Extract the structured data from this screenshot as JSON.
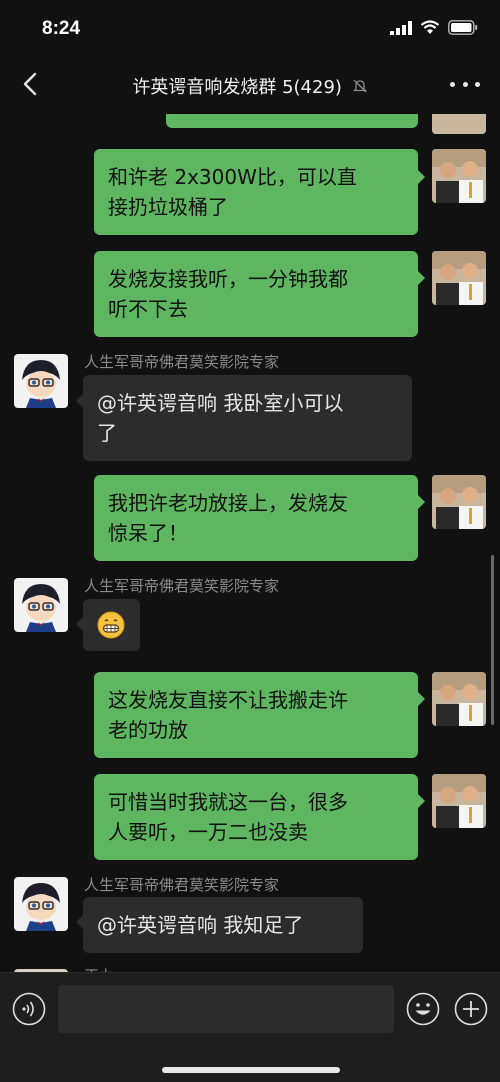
{
  "status": {
    "time": "8:24"
  },
  "header": {
    "title": "许英谔音响发烧群 5(429)"
  },
  "sender_name": "人生军哥帝佛君莫笑影院专家",
  "partial_sender": "王力",
  "messages": [
    {
      "from": "me",
      "line1": "和许老 2x300W比，可以直",
      "line2": "接扔垃圾桶了"
    },
    {
      "from": "me",
      "line1": "发烧友接我听，一分钟我都",
      "line2": "听不下去"
    },
    {
      "from": "them",
      "line1": "@许英谔音响 我卧室小可以",
      "line2": "了"
    },
    {
      "from": "me",
      "line1": "我把许老功放接上，发烧友",
      "line2": "惊呆了！"
    },
    {
      "from": "them",
      "emoji": "grinning-face"
    },
    {
      "from": "me",
      "line1": "这发烧友直接不让我搬走许",
      "line2": "老的功放"
    },
    {
      "from": "me",
      "line1": "可惜当时我就这一台，很多",
      "line2": "人要听，一万二也没卖"
    },
    {
      "from": "them",
      "line1": "@许英谔音响 我知足了"
    }
  ],
  "colors": {
    "bubble_me": "#5fb660",
    "bubble_them": "#2c2c2c",
    "background": "#111111"
  },
  "icons": [
    "back-arrow-icon",
    "mute-bell-icon",
    "more-icon",
    "voice-icon",
    "emoji-icon",
    "plus-icon"
  ]
}
